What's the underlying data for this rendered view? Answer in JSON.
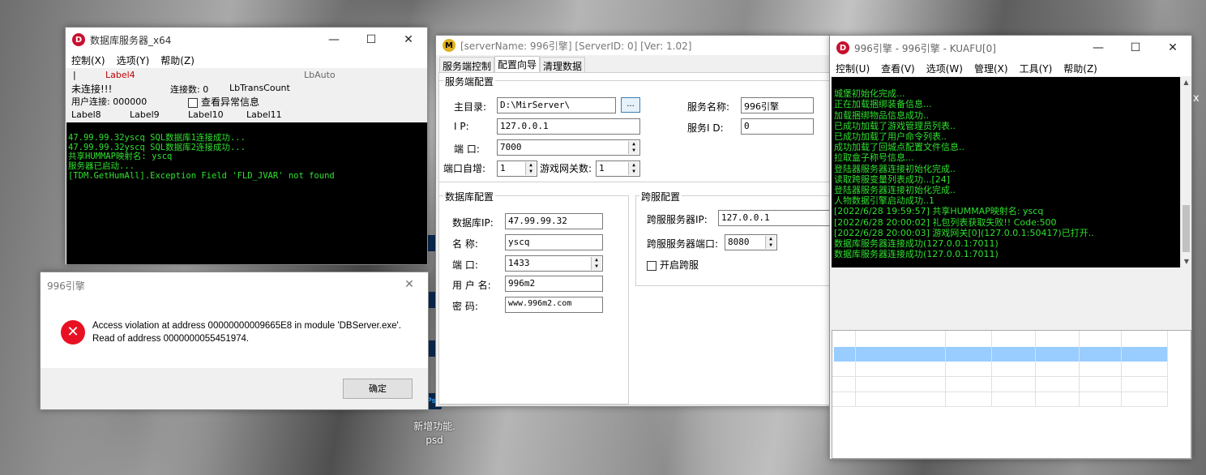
{
  "desktop": {
    "icon_label_1": "新增功能.",
    "icon_label_2": "psd",
    "side_fragments": [
      "Ps",
      "能",
      "Ps",
      "作",
      "P",
      "Ps"
    ]
  },
  "db_window": {
    "title": "数据库服务器_x64",
    "menu": [
      "控制(X)",
      "选项(Y)",
      "帮助(Z)"
    ],
    "label4": "Label4",
    "lbauto": "LbAuto",
    "status": "未连接!!!",
    "conn_count": "连接数: 0",
    "lbtranscount": "LbTransCount",
    "user_conn": "用户连接: 000000",
    "check_label": "查看异常信息",
    "labels": [
      "Label8",
      "Label9",
      "Label10",
      "Label11"
    ],
    "log": [
      "47.99.99.32yscq SQL数据库1连接成功...",
      "47.99.99.32yscq SQL数据库2连接成功...",
      "共享HUMMAP映射名: yscq",
      "服务器已启动...",
      "[TDM.GetHumAll].Exception Field 'FLD_JVAR' not found"
    ]
  },
  "error_dialog": {
    "title": "996引擎",
    "line1": "Access violation at address 00000000009665E8 in module 'DBServer.exe'.",
    "line2": "Read of address 0000000055451974.",
    "ok": "确定"
  },
  "server_window": {
    "title": "[serverName: 996引擎] [ServerID: 0] [Ver:  1.02]",
    "tabs": [
      "服务端控制",
      "配置向导",
      "清理数据"
    ],
    "server_group": "服务端配置",
    "home_label": "主目录:",
    "home_value": "D:\\MirServer\\",
    "browse": "...",
    "ip_label": "I    P:",
    "ip_value": "127.0.0.1",
    "port_label": "端   口:",
    "port_value": "7000",
    "autoinc_label": "端口自增:",
    "autoinc_value": "1",
    "gate_label": "游戏网关数:",
    "gate_value": "1",
    "name_label": "服务名称:",
    "name_value": "996引擎",
    "id_label": "服务I  D:",
    "id_value": "0",
    "db_group": "数据库配置",
    "db_ip_label": "数据库IP:",
    "db_ip_value": "47.99.99.32",
    "db_name_label": "名    称:",
    "db_name_value": "yscq",
    "db_port_label": "端    口:",
    "db_port_value": "1433",
    "db_user_label": "用 户 名:",
    "db_user_value": "996m2",
    "db_pwd_label": "密    码:",
    "db_pwd_value": "www.996m2.com",
    "cross_group": "跨服配置",
    "cross_ip_label": "跨服服务器IP:",
    "cross_ip_value": "127.0.0.1",
    "cross_port_label": "跨服服务器端口:",
    "cross_port_value": "8080",
    "cross_enable": "开启跨服"
  },
  "kuafu_window": {
    "title": "996引擎 - 996引擎 - KUAFU[0]",
    "menu": [
      "控制(U)",
      "查看(V)",
      "选项(W)",
      "管理(X)",
      "工具(Y)",
      "帮助(Z)"
    ],
    "log": [
      "城堡初始化完成...",
      "正在加载捆绑装备信息...",
      "加载捆绑物品信息成功..",
      "已成功加载了游戏管理员列表..",
      "已成功加载了用户命令列表..",
      "成功加载了回城点配置文件信息..",
      "拉取盒子称号信息...",
      "登陆器服务器连接初始化完成..",
      "读取跨服变量列表成功...[24]",
      "登陆器服务器连接初始化完成..",
      "人物数据引擎启动成功..1",
      "[2022/6/28 19:59:57] 共享HUMMAP映射名: yscq",
      "[2022/6/28 20:00:02] 礼包列表获取失败!! Code:500",
      "[2022/6/28 20:00:03] 游戏网关[0](127.0.0.1:50417)已打开..",
      "数据库服务器连接成功(127.0.0.1:7011)",
      "数据库服务器连接成功(127.0.0.1:7011)"
    ],
    "x_fragment": "x"
  }
}
